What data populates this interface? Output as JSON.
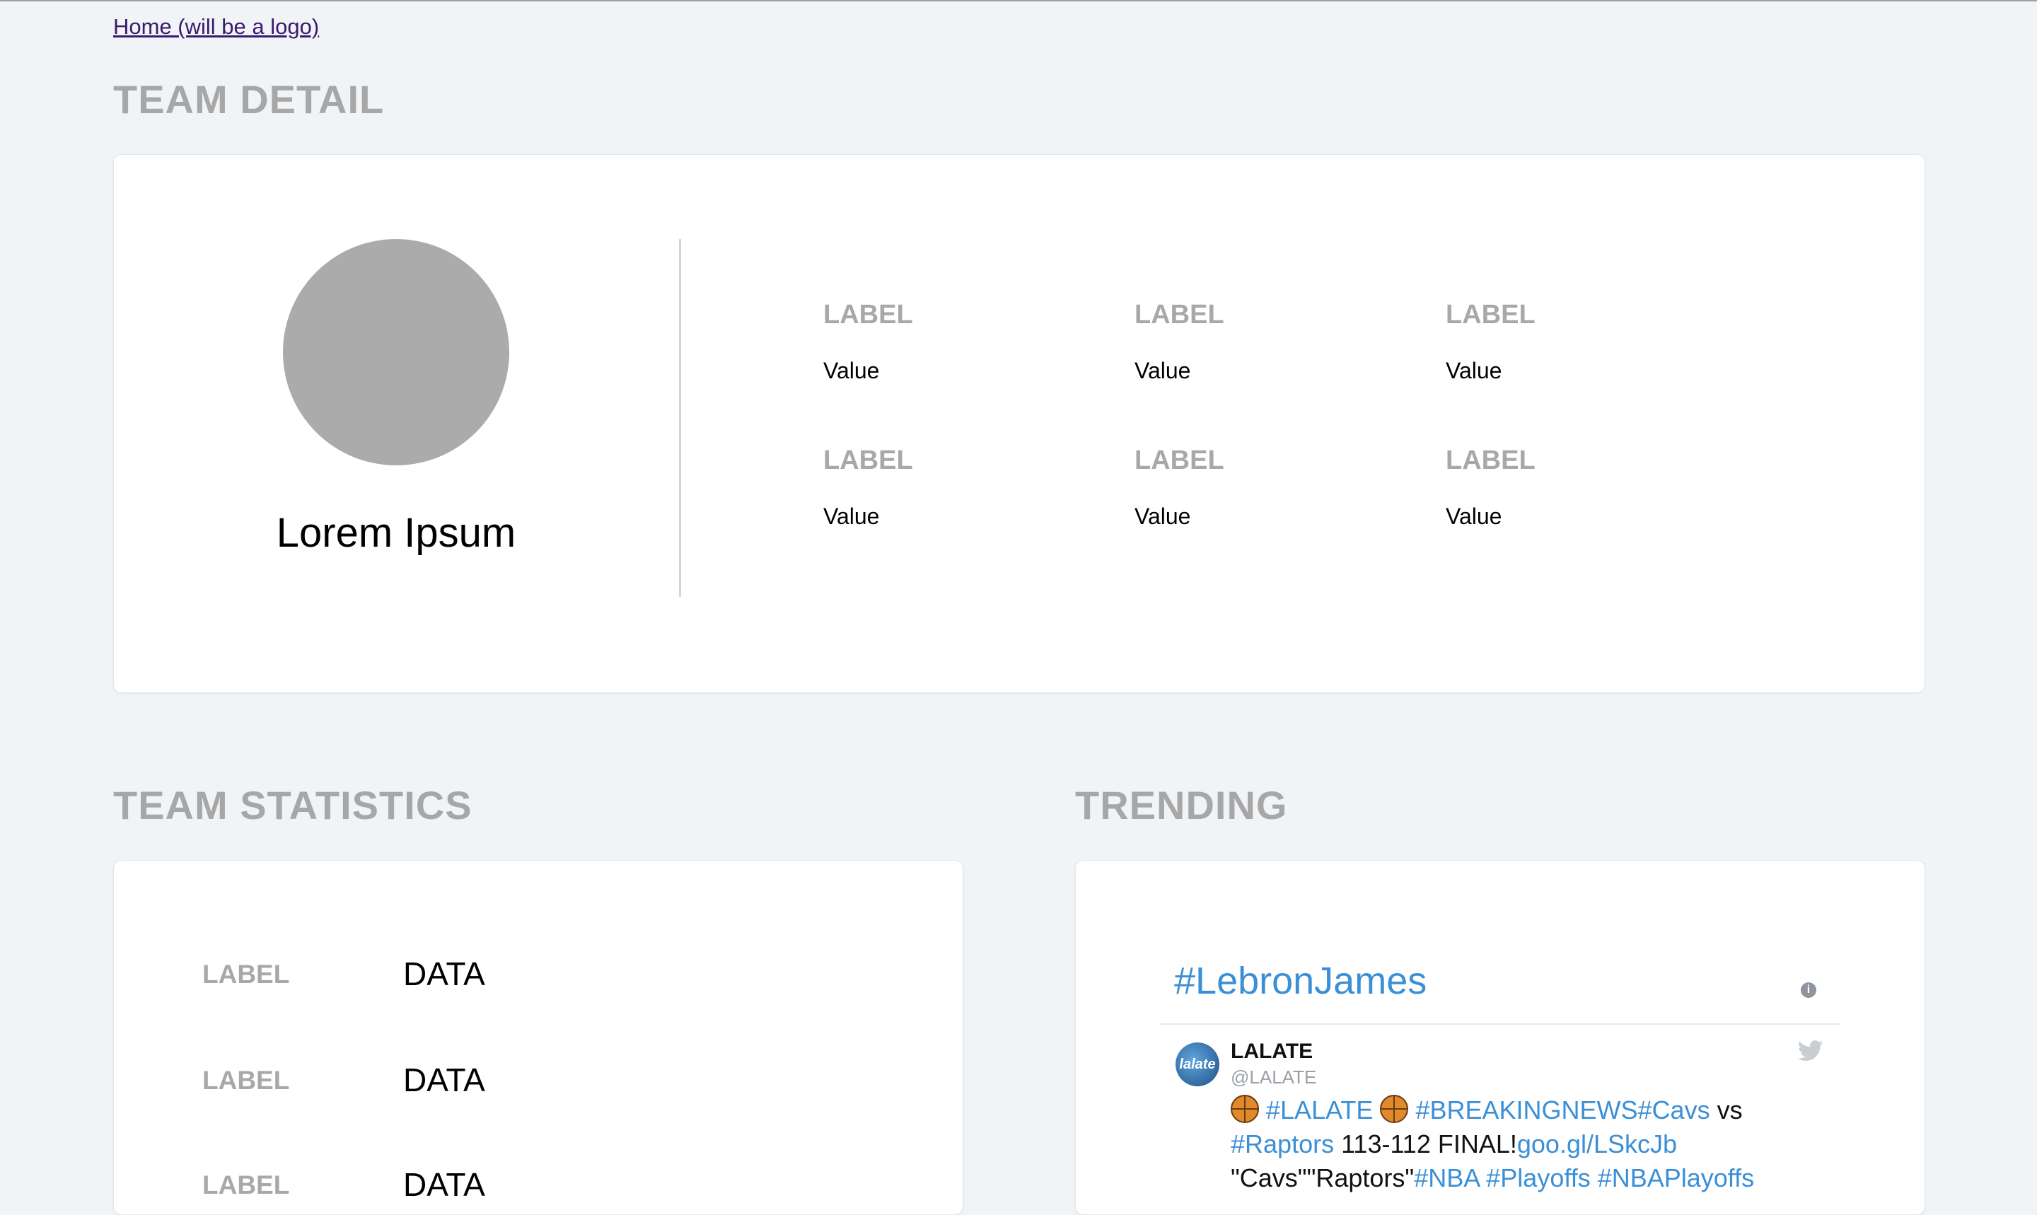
{
  "nav": {
    "home_link": "Home (will be a logo)"
  },
  "team_detail": {
    "title": "TEAM DETAIL",
    "team_name": "Lorem Ipsum",
    "fields": [
      {
        "label": "LABEL",
        "value": "Value"
      },
      {
        "label": "LABEL",
        "value": "Value"
      },
      {
        "label": "LABEL",
        "value": "Value"
      },
      {
        "label": "LABEL",
        "value": "Value"
      },
      {
        "label": "LABEL",
        "value": "Value"
      },
      {
        "label": "LABEL",
        "value": "Value"
      }
    ]
  },
  "team_statistics": {
    "title": "TEAM STATISTICS",
    "rows": [
      {
        "label": "LABEL",
        "data": "DATA"
      },
      {
        "label": "LABEL",
        "data": "DATA"
      },
      {
        "label": "LABEL",
        "data": "DATA"
      }
    ]
  },
  "trending": {
    "title": "TRENDING",
    "hashtag": "#LebronJames",
    "info_icon": "info-icon",
    "tweet": {
      "avatar_text": "lalate",
      "name": "LALATE",
      "handle": "@LALATE",
      "icon": "twitter-bird-icon",
      "line1_tag1": "#LALATE",
      "line1_tag2": "#BREAKINGNEWS#Cavs",
      "line1_text": " vs",
      "line2_tag": "#Raptors",
      "line2_text": " 113-112 FINAL!",
      "line2_link": "goo.gl/LSkcJb",
      "line3_text": "\"Cavs\"\"Raptors\"",
      "line3_tags": "#NBA #Playoffs #NBAPlayoffs"
    }
  },
  "colors": {
    "background": "#f1f4f7",
    "card": "#ffffff",
    "section_title": "#a7a7a7",
    "link_blue": "#3b8fd6",
    "avatar_gray": "#ababab"
  }
}
